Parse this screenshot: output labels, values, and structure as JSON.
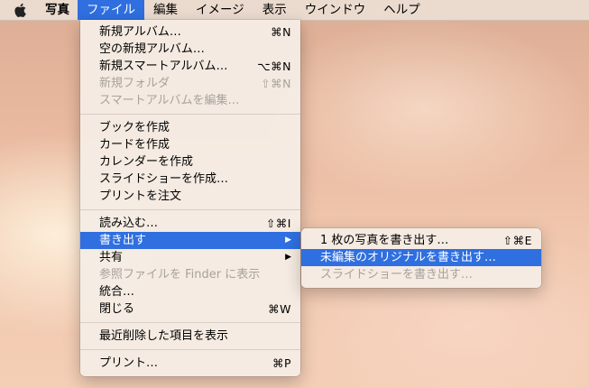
{
  "menubar": {
    "app": "写真",
    "items": [
      "ファイル",
      "編集",
      "イメージ",
      "表示",
      "ウインドウ",
      "ヘルプ"
    ]
  },
  "file_menu": {
    "group1": [
      {
        "label": "新規アルバム…",
        "shortcut": "⌘N"
      },
      {
        "label": "空の新規アルバム…",
        "shortcut": ""
      },
      {
        "label": "新規スマートアルバム…",
        "shortcut": "⌥⌘N"
      },
      {
        "label": "新規フォルダ",
        "shortcut": "⇧⌘N"
      },
      {
        "label": "スマートアルバムを編集…",
        "shortcut": ""
      }
    ],
    "group2": [
      {
        "label": "ブックを作成"
      },
      {
        "label": "カードを作成"
      },
      {
        "label": "カレンダーを作成"
      },
      {
        "label": "スライドショーを作成…"
      },
      {
        "label": "プリントを注文"
      }
    ],
    "group3": [
      {
        "label": "読み込む…",
        "shortcut": "⇧⌘I"
      },
      {
        "label": "書き出す",
        "shortcut": "▶"
      },
      {
        "label": "共有",
        "shortcut": "▶"
      },
      {
        "label": "参照ファイルを Finder に表示",
        "shortcut": ""
      },
      {
        "label": "統合…",
        "shortcut": ""
      },
      {
        "label": "閉じる",
        "shortcut": "⌘W"
      }
    ],
    "group4": [
      {
        "label": "最近削除した項目を表示"
      }
    ],
    "group5": [
      {
        "label": "プリント…",
        "shortcut": "⌘P"
      }
    ]
  },
  "export_submenu": [
    {
      "label": "1 枚の写真を書き出す…",
      "shortcut": "⇧⌘E"
    },
    {
      "label": "未編集のオリジナルを書き出す…",
      "shortcut": ""
    },
    {
      "label": "スライドショーを書き出す…",
      "shortcut": ""
    }
  ]
}
